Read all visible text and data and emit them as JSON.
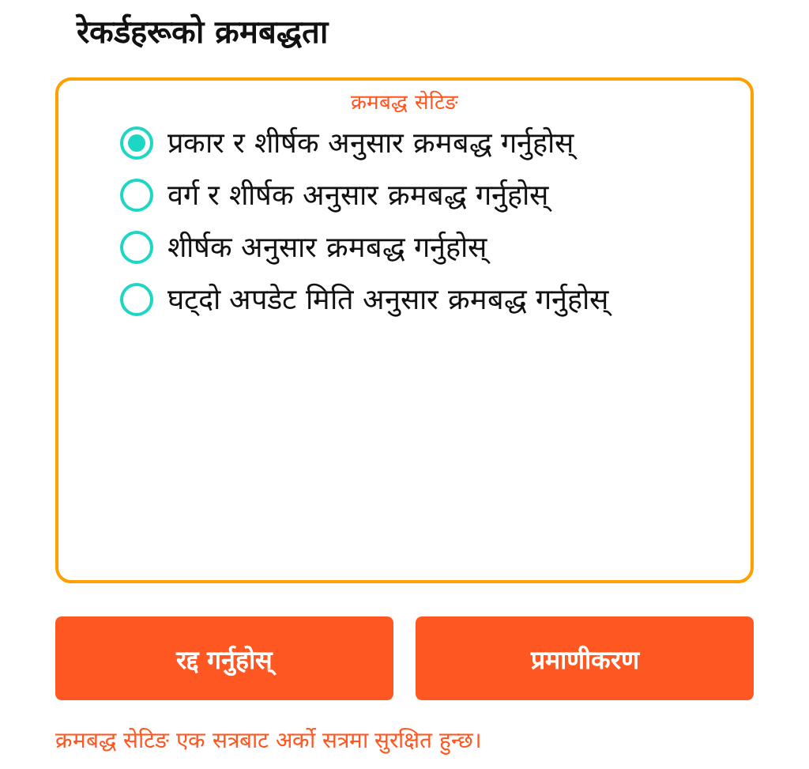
{
  "title": "रेकर्डहरूको क्रमबद्धता",
  "group": {
    "legend": "क्रमबद्ध सेटिङ",
    "options": [
      {
        "label": "प्रकार र शीर्षक अनुसार क्रमबद्ध गर्नुहोस्",
        "selected": true
      },
      {
        "label": "वर्ग र शीर्षक अनुसार क्रमबद्ध गर्नुहोस्",
        "selected": false
      },
      {
        "label": "शीर्षक अनुसार क्रमबद्ध गर्नुहोस्",
        "selected": false
      },
      {
        "label": "घट्दो अपडेट मिति अनुसार क्रमबद्ध गर्नुहोस्",
        "selected": false
      }
    ]
  },
  "buttons": [
    "रद्द गर्नुहोस्",
    "प्रमाणीकरण"
  ],
  "note": "क्रमबद्ध सेटिङ एक सत्रबाट अर्को सत्रमा सुरक्षित हुन्छ।"
}
